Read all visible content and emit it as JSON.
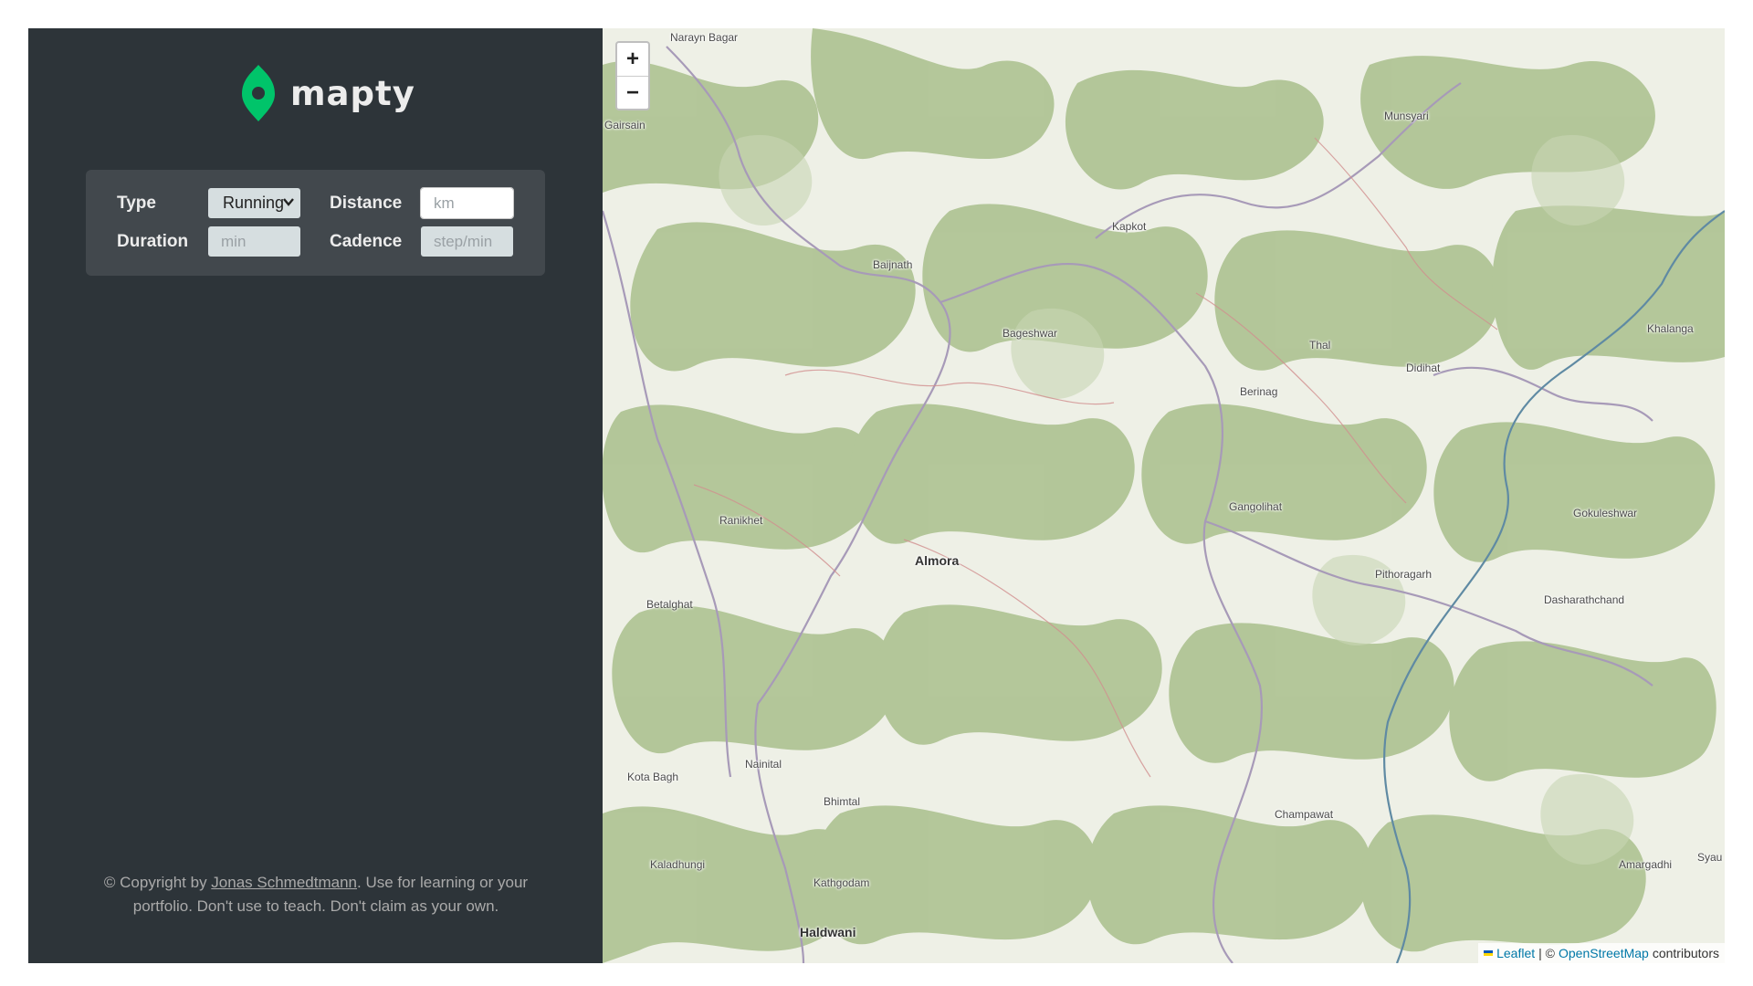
{
  "app": {
    "name": "mapty"
  },
  "colors": {
    "brand": "#00c46a",
    "sidebar_bg": "#2d3439",
    "form_bg": "#42484d"
  },
  "form": {
    "type_label": "Type",
    "type_value": "Running",
    "distance_label": "Distance",
    "distance_placeholder": "km",
    "duration_label": "Duration",
    "duration_placeholder": "min",
    "cadence_label": "Cadence",
    "cadence_placeholder": "step/min"
  },
  "copyright": {
    "prefix": "© Copyright by ",
    "author": "Jonas Schmedtmann",
    "suffix": ". Use for learning or your portfolio. Don't use to teach. Don't claim as your own."
  },
  "map": {
    "zoom_in": "+",
    "zoom_out": "−",
    "places": [
      "Narayn Bagar",
      "Gairsain",
      "Munsyari",
      "Kapkot",
      "Baijnath",
      "Bageshwar",
      "Thal",
      "Didihat",
      "Khalanga",
      "Berinag",
      "Gangolihat",
      "Ranikhet",
      "Almora",
      "Pithoragarh",
      "Gokuleshwar",
      "Betalghat",
      "Dasharathchand",
      "Kota Bagh",
      "Nainital",
      "Bhimtal",
      "Champawat",
      "Kaladhungi",
      "Kathgodam",
      "Haldwani",
      "Amargadhi",
      "Syau"
    ],
    "attribution": {
      "leaflet": "Leaflet",
      "separator": "| ©",
      "osm": "OpenStreetMap",
      "contributors": "contributors"
    }
  }
}
